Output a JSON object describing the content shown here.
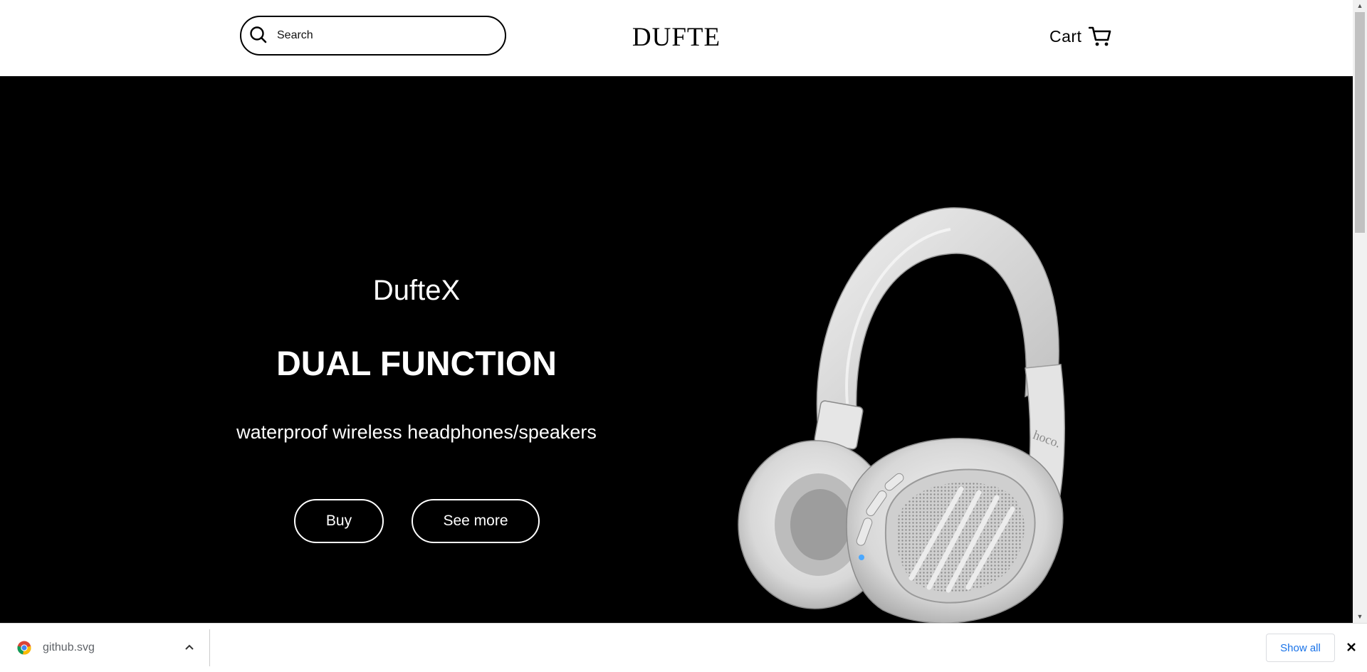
{
  "header": {
    "search": {
      "placeholder": "Search",
      "icon": "search-icon"
    },
    "logo": "DUFTE",
    "cart": {
      "label": "Cart",
      "icon": "cart-icon"
    }
  },
  "hero": {
    "brand": "DufteX",
    "headline": "DUAL FUNCTION",
    "tagline": "waterproof wireless headphones/speakers",
    "buttons": {
      "buy": "Buy",
      "see_more": "See more"
    },
    "product_image": "white-headphones",
    "product_logo": "hoco."
  },
  "download_bar": {
    "item": {
      "filename": "github.svg",
      "icon": "chrome-icon"
    },
    "show_all": "Show all",
    "close_icon": "close-icon"
  },
  "colors": {
    "header_bg": "#ffffff",
    "hero_bg": "#000000",
    "hero_text": "#ffffff",
    "link_blue": "#1a73e8"
  }
}
